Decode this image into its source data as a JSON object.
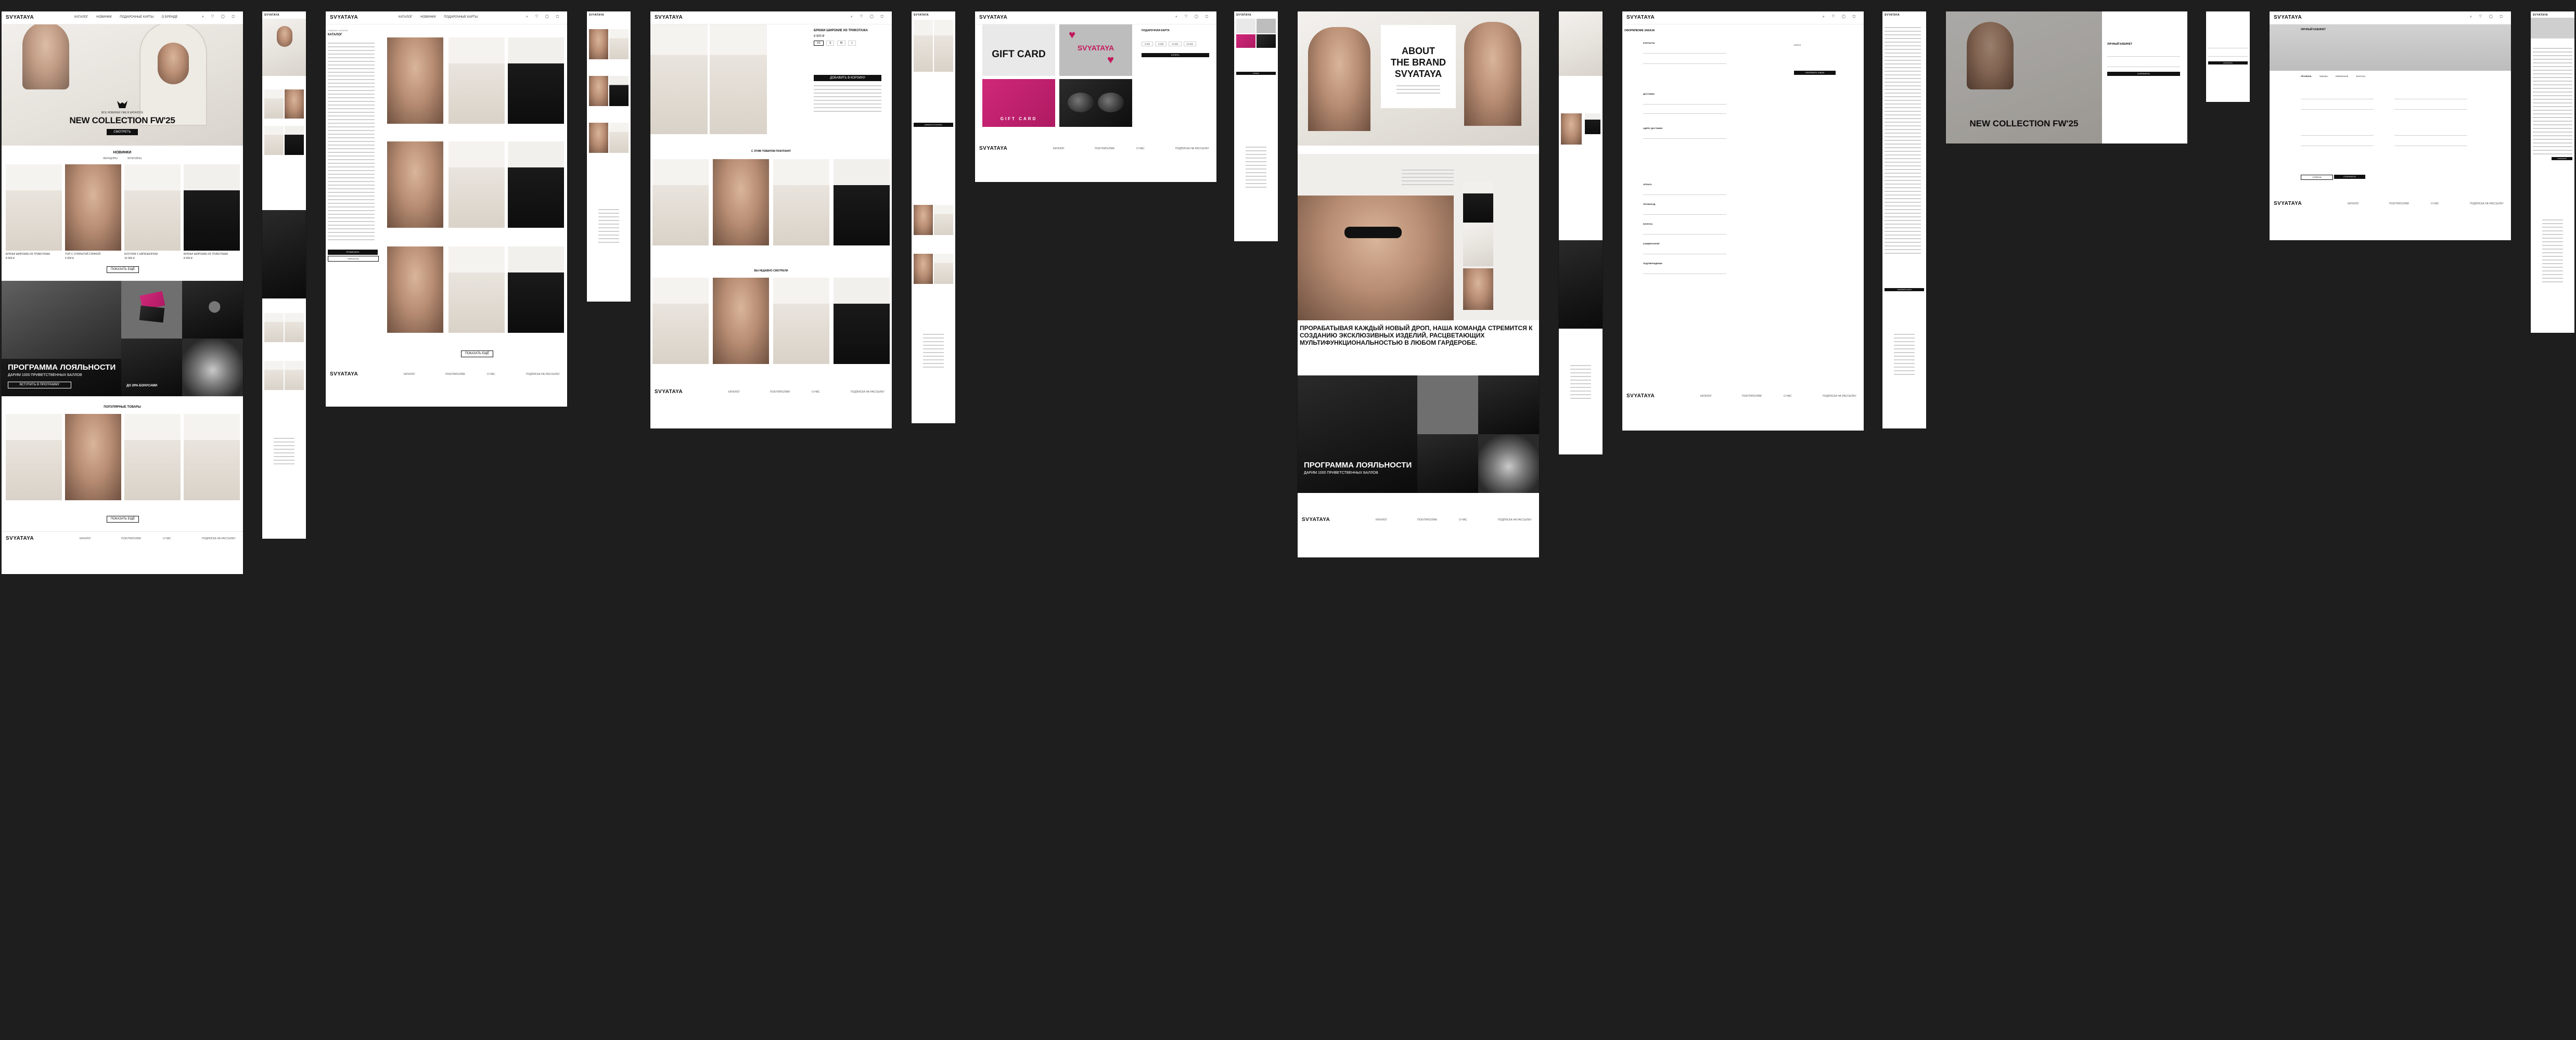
{
  "brand": {
    "logo": "SVYATAYA",
    "nav": [
      "КАТАЛОГ",
      "НОВИНКИ",
      "ПОДАРОЧНЫЕ КАРТЫ",
      "О БРЕНДЕ",
      "КОНТАКТЫ"
    ],
    "header_icons": [
      "search-icon",
      "heart-icon",
      "user-icon",
      "bag-icon"
    ]
  },
  "home": {
    "hero_title": "NEW COLLECTION FW'25",
    "hero_subtitle": "ВСЕ НОВИНКИ УЖЕ В КАТАЛОГЕ",
    "hero_button": "СМОТРЕТЬ",
    "section_new": "НОВИНКИ",
    "section_tabs": [
      "ЖЕНЩИНЫ",
      "МУЖЧИНЫ"
    ],
    "products": [
      {
        "name": "БРЮКИ ШИРОКИЕ ИЗ ТРИКОТАЖА",
        "price": "8 900 ₽"
      },
      {
        "name": "ТОП С ОТКРЫТОЙ СПИНОЙ",
        "price": "5 900 ₽"
      },
      {
        "name": "КОСТЮМ С КАПЮШОНОМ",
        "price": "14 900 ₽"
      },
      {
        "name": "БРЮКИ ШИРОКИЕ ИЗ ТРИКОТАЖА",
        "price": "8 900 ₽"
      }
    ],
    "show_more": "ПОКАЗАТЬ ЕЩЁ",
    "loyalty_title": "ПРОГРАММА ЛОЯЛЬНОСТИ",
    "loyalty_subtitle": "ДАРИМ 1000 ПРИВЕТСТВЕННЫХ БАЛЛОВ",
    "loyalty_button": "ВСТУПИТЬ В ПРОГРАММУ",
    "loyalty_label": "ДО 20% БОНУСАМИ",
    "section_popular": "ПОПУЛЯРНЫЕ ТОВАРЫ"
  },
  "catalog": {
    "breadcrumb": "ГЛАВНАЯ / КАТАЛОГ",
    "title": "КАТАЛОГ",
    "filters": [
      "КАТЕГОРИЯ",
      "РАЗМЕР",
      "ЦВЕТ",
      "ЦЕНА",
      "МАТЕРИАЛ",
      "КОЛЛЕКЦИЯ"
    ],
    "apply": "ПРИМЕНИТЬ",
    "reset": "СБРОСИТЬ"
  },
  "product": {
    "name": "БРЮКИ ШИРОКИЕ ИЗ ТРИКОТАЖА",
    "price": "8 900 ₽",
    "sizes": [
      "XS",
      "S",
      "M",
      "L"
    ],
    "add_to_cart": "ДОБАВИТЬ В КОРЗИНУ",
    "related": "С ЭТИМ ТОВАРОМ ПОКУПАЮТ",
    "recent": "ВЫ НЕДАВНО СМОТРЕЛИ"
  },
  "giftcard": {
    "card_label_1": "GIFT CARD",
    "card_label_2": "SVYATAYA",
    "card_label_3": "GIFT CARD",
    "title": "ПОДАРОЧНАЯ КАРТА",
    "amounts": [
      "3 000",
      "5 000",
      "10 000",
      "15 000"
    ],
    "buy": "КУПИТЬ"
  },
  "about": {
    "title_1": "ABOUT",
    "title_2": "THE BRAND",
    "title_3": "SVYATAYA",
    "manifesto": "ПРОРАБАТЫВАЯ КАЖДЫЙ НОВЫЙ ДРОП, НАША КОМАНДА СТРЕМИТСЯ К СОЗДАНИЮ ЭКСКЛЮЗИВНЫХ ИЗДЕЛИЙ, РАСЦВЕТАЮЩИХ МУЛЬТИФУНКЦИОНАЛЬНОСТЬЮ В ЛЮБОМ ГАРДЕРОБЕ."
  },
  "checkout": {
    "title": "ОФОРМЛЕНИЕ ЗАКАЗА",
    "steps": [
      "КОНТАКТЫ",
      "ДОСТАВКА",
      "АДРЕС ДОСТАВКИ",
      "ОПЛАТА",
      "ПРОМОКОД",
      "БОНУСЫ",
      "КОММЕНТАРИЙ",
      "ПОДТВЕРЖДЕНИЕ"
    ],
    "submit": "ОФОРМИТЬ ЗАКАЗ",
    "total": "ИТОГО"
  },
  "account": {
    "title": "ЛИЧНЫЙ КАБИНЕТ",
    "tabs": [
      "ПРОФИЛЬ",
      "ЗАКАЗЫ",
      "ИЗБРАННОЕ",
      "БОНУСЫ"
    ],
    "save": "СОХРАНИТЬ",
    "cancel": "ОТМЕНА"
  },
  "footer": {
    "cols": [
      "КАТАЛОГ",
      "ПОКУПАТЕЛЯМ",
      "О НАС",
      "ПОДПИСКА НА РАССЫЛКУ"
    ],
    "subscribe": "ПОДПИСАТЬСЯ"
  }
}
